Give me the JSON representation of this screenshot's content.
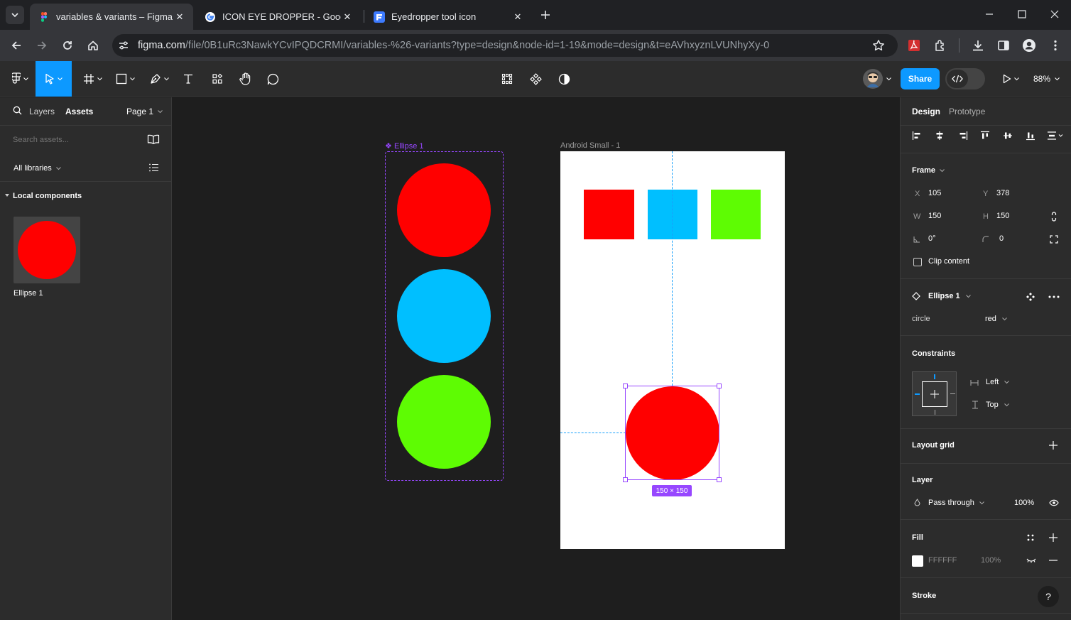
{
  "browser": {
    "tabs": [
      {
        "title": "variables & variants – Figma",
        "favicon": "figma-icon",
        "active": true
      },
      {
        "title": "ICON EYE DROPPER - Google Se",
        "favicon": "google-icon",
        "active": false
      },
      {
        "title": "Eyedropper tool icon",
        "favicon": "flaticon-icon",
        "active": false
      }
    ],
    "url_host": "figma.com",
    "url_path": "/file/0B1uRc3NawkYCvIPQDCRMI/variables-%26-variants?type=design&node-id=1-19&mode=design&t=eAVhxyznLVUNhyXy-0"
  },
  "toolbar": {
    "share_label": "Share",
    "zoom": "88%"
  },
  "left_panel": {
    "tabs": {
      "layers": "Layers",
      "assets": "Assets"
    },
    "page": "Page 1",
    "search_placeholder": "Search assets...",
    "libraries": "All libraries",
    "section": "Local components",
    "component": {
      "name": "Ellipse 1",
      "color": "#ff0000"
    }
  },
  "canvas": {
    "component_set_label": "Ellipse 1",
    "frame_label": "Android Small - 1",
    "variant_colors": [
      "#ff0000",
      "#00bfff",
      "#5efc03"
    ],
    "swatches": [
      "#ff0000",
      "#00bfff",
      "#5efc03"
    ],
    "selected_circle_color": "#ff0000",
    "size_tag": "150 × 150"
  },
  "right_panel": {
    "tabs": {
      "design": "Design",
      "prototype": "Prototype"
    },
    "frame": {
      "title": "Frame",
      "x_label": "X",
      "x": "105",
      "y_label": "Y",
      "y": "378",
      "w_label": "W",
      "w": "150",
      "h_label": "H",
      "h": "150",
      "rotation": "0°",
      "radius": "0",
      "clip_content": "Clip content"
    },
    "instance": {
      "name": "Ellipse 1",
      "property": "circle",
      "value": "red"
    },
    "constraints": {
      "title": "Constraints",
      "horizontal": "Left",
      "vertical": "Top"
    },
    "layout_grid": "Layout grid",
    "layer": {
      "title": "Layer",
      "blend": "Pass through",
      "opacity": "100%"
    },
    "fill": {
      "title": "Fill",
      "hex": "FFFFFF",
      "opacity": "100%"
    },
    "stroke": "Stroke",
    "help": "?"
  }
}
